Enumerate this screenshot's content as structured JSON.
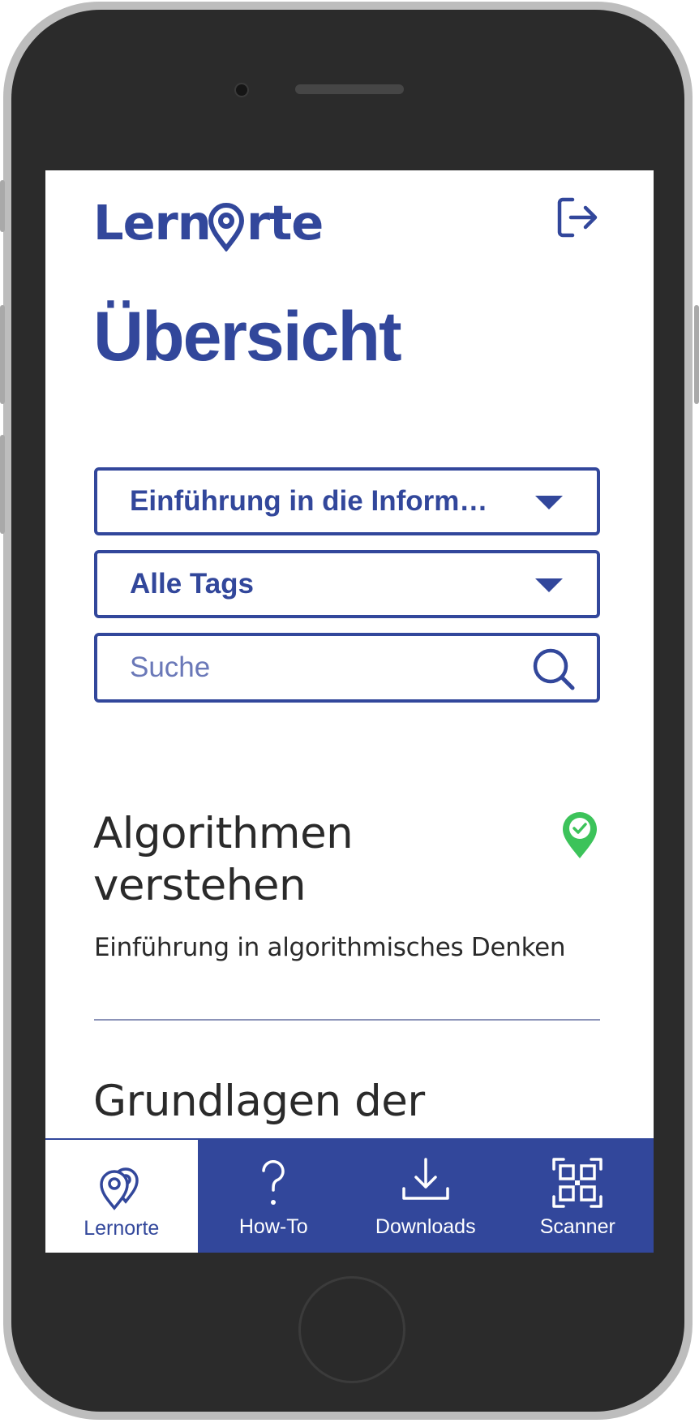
{
  "app": {
    "logo_text": "Lernorte"
  },
  "header": {
    "logout_icon": "logout-icon"
  },
  "page": {
    "title": "Übersicht"
  },
  "filters": {
    "course_select": "Einführung in die Inform…",
    "tags_select": "Alle Tags",
    "search_placeholder": "Suche"
  },
  "items": [
    {
      "title_line1": "Algorithmen",
      "title_line2": "verstehen",
      "subtitle": "Einführung in algorithmisches Denken",
      "status": "completed",
      "status_color": "#3cc35a"
    },
    {
      "title_line1": "Grundlagen der"
    }
  ],
  "nav": {
    "items": [
      {
        "label": "Lernorte",
        "icon": "map-pins-icon",
        "active": true
      },
      {
        "label": "How-To",
        "icon": "question-icon",
        "active": false
      },
      {
        "label": "Downloads",
        "icon": "download-icon",
        "active": false
      },
      {
        "label": "Scanner",
        "icon": "qr-scanner-icon",
        "active": false
      }
    ]
  },
  "colors": {
    "primary": "#32479b",
    "text": "#2a2a2a",
    "success": "#3cc35a",
    "frame": "#2b2b2b"
  }
}
